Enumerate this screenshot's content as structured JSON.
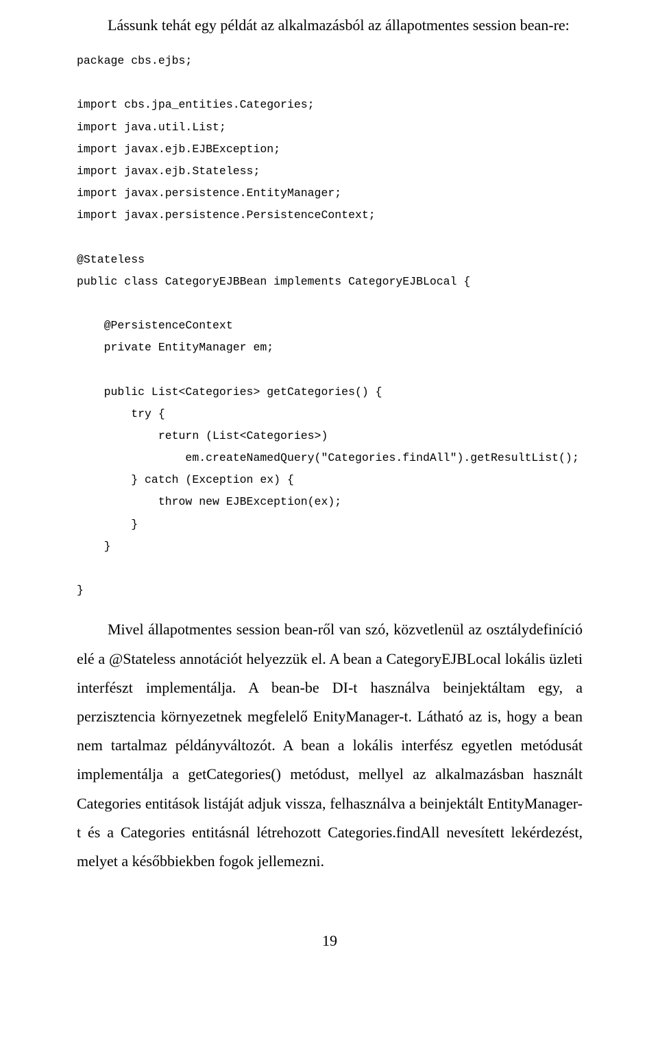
{
  "intro": "Lássunk tehát egy példát az alkalmazásból az állapotmentes session bean-re:",
  "code": "package cbs.ejbs;\n\nimport cbs.jpa_entities.Categories;\nimport java.util.List;\nimport javax.ejb.EJBException;\nimport javax.ejb.Stateless;\nimport javax.persistence.EntityManager;\nimport javax.persistence.PersistenceContext;\n\n@Stateless\npublic class CategoryEJBBean implements CategoryEJBLocal {\n\n    @PersistenceContext\n    private EntityManager em;\n\n    public List<Categories> getCategories() {\n        try {\n            return (List<Categories>)\n                em.createNamedQuery(\"Categories.findAll\").getResultList();\n        } catch (Exception ex) {\n            throw new EJBException(ex);\n        }\n    }\n\n}",
  "paragraph": "Mivel állapotmentes session bean-ről van szó, közvetlenül az osztálydefiníció elé a @Stateless annotációt helyezzük el. A bean a CategoryEJBLocal lokális üzleti interfészt implementálja. A bean-be DI-t használva beinjektáltam egy, a perzisztencia környezetnek megfelelő EnityManager-t. Látható az is, hogy a bean nem tartalmaz példányváltozót. A bean a lokális interfész egyetlen metódusát implementálja a getCategories() metódust, mellyel az alkalmazásban használt Categories entitások listáját adjuk vissza, felhasználva a beinjektált EntityManager-t és a Categories entitásnál létrehozott Categories.findAll nevesített lekérdezést, melyet a későbbiekben fogok jellemezni.",
  "page_number": "19"
}
